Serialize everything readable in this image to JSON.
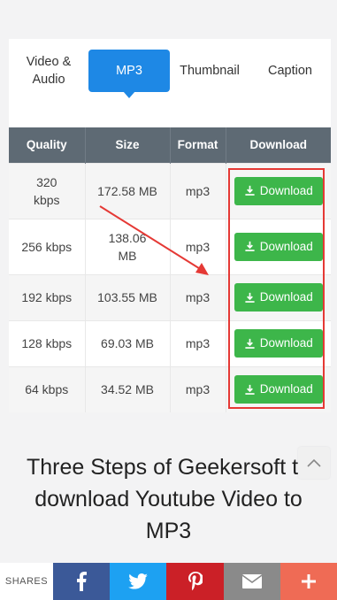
{
  "tabs": [
    {
      "label_line1": "Video &",
      "label_line2": "Audio"
    },
    {
      "label": "MP3"
    },
    {
      "label": "Thumbnail"
    },
    {
      "label": "Caption"
    }
  ],
  "table": {
    "headers": [
      "Quality",
      "Size",
      "Format",
      "Download"
    ],
    "rows": [
      {
        "quality_line1": "320",
        "quality_line2": "kbps",
        "size": "172.58 MB",
        "format": "mp3",
        "button": "Download"
      },
      {
        "quality": "256 kbps",
        "size_line1": "138.06",
        "size_line2": "MB",
        "format": "mp3",
        "button": "Download"
      },
      {
        "quality": "192 kbps",
        "size": "103.55 MB",
        "format": "mp3",
        "button": "Download"
      },
      {
        "quality": "128 kbps",
        "size": "69.03 MB",
        "format": "mp3",
        "button": "Download"
      },
      {
        "quality": "64 kbps",
        "size": "34.52 MB",
        "format": "mp3",
        "button": "Download"
      }
    ]
  },
  "heading": "Three Steps of Geekersoft to download Youtube Video to MP3",
  "sharebar": {
    "label": "SHARES",
    "buttons": [
      "facebook-icon",
      "twitter-icon",
      "pinterest-icon",
      "mail-icon",
      "plus-icon"
    ]
  },
  "colors": {
    "tab_active": "#1e88e5",
    "table_header": "#5e6a74",
    "download_button": "#3db64a",
    "highlight": "#e53935",
    "facebook": "#3b5998",
    "twitter": "#1da1f2",
    "pinterest": "#cb2027",
    "mail": "#8a8a8a",
    "more": "#ef6b55"
  }
}
